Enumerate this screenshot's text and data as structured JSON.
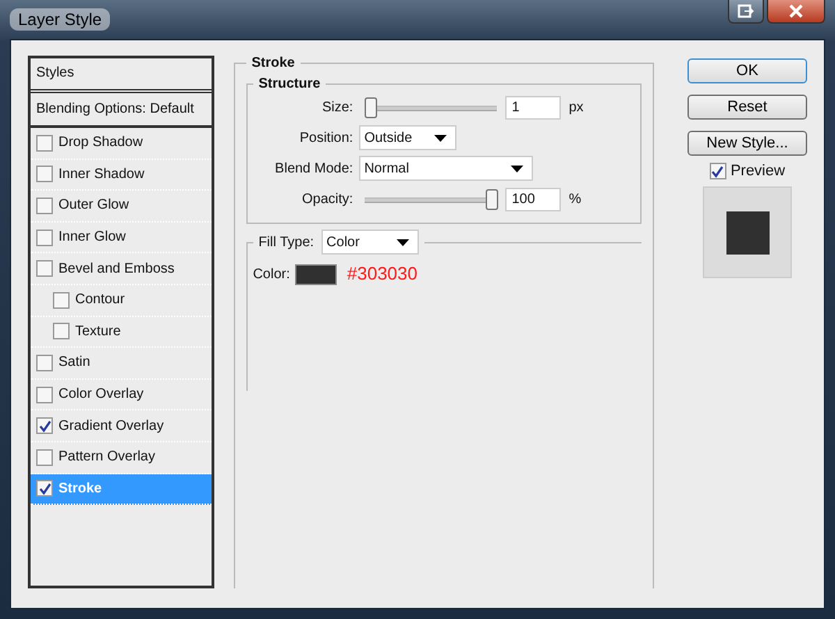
{
  "window": {
    "title": "Layer Style"
  },
  "styles_list": {
    "header": "Styles",
    "blending": "Blending Options: Default",
    "items": [
      {
        "label": "Drop Shadow",
        "checked": false,
        "selected": false
      },
      {
        "label": "Inner Shadow",
        "checked": false,
        "selected": false
      },
      {
        "label": "Outer Glow",
        "checked": false,
        "selected": false
      },
      {
        "label": "Inner Glow",
        "checked": false,
        "selected": false
      },
      {
        "label": "Bevel and Emboss",
        "checked": false,
        "selected": false,
        "children": [
          {
            "label": "Contour",
            "checked": false,
            "selected": false
          },
          {
            "label": "Texture",
            "checked": false,
            "selected": false
          }
        ]
      },
      {
        "label": "Satin",
        "checked": false,
        "selected": false
      },
      {
        "label": "Color Overlay",
        "checked": false,
        "selected": false
      },
      {
        "label": "Gradient Overlay",
        "checked": true,
        "selected": false
      },
      {
        "label": "Pattern Overlay",
        "checked": false,
        "selected": false
      },
      {
        "label": "Stroke",
        "checked": true,
        "selected": true
      }
    ]
  },
  "stroke": {
    "title": "Stroke",
    "structure": {
      "title": "Structure",
      "size": {
        "label": "Size:",
        "level": 0,
        "value": "1",
        "unit": "px"
      },
      "position": {
        "label": "Position:",
        "value": "Outside"
      },
      "blend_mode": {
        "label": "Blend Mode:",
        "value": "Normal"
      },
      "opacity": {
        "label": "Opacity:",
        "level": 1,
        "value": "100",
        "unit": "%"
      }
    },
    "fill_type": {
      "label": "Fill Type:",
      "value": "Color"
    },
    "color": {
      "label": "Color:",
      "hex": "#303030"
    }
  },
  "buttons": [
    "OK",
    "Reset",
    "New Style..."
  ],
  "preview": {
    "label": "Preview",
    "checked": true
  }
}
